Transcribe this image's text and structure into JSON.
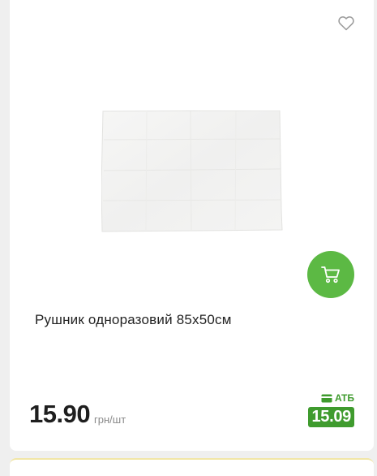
{
  "product": {
    "title": "Рушник одноразовий 85х50см",
    "price": "15.90",
    "unit": "грн/шт",
    "card_label": "АТБ",
    "card_price": "15.09"
  },
  "icons": {
    "favorite": "heart-outline-icon",
    "cart": "cart-icon",
    "loyalty_card": "card-icon"
  },
  "colors": {
    "accent_green": "#5cb944",
    "card_green": "#3f9b2e"
  }
}
